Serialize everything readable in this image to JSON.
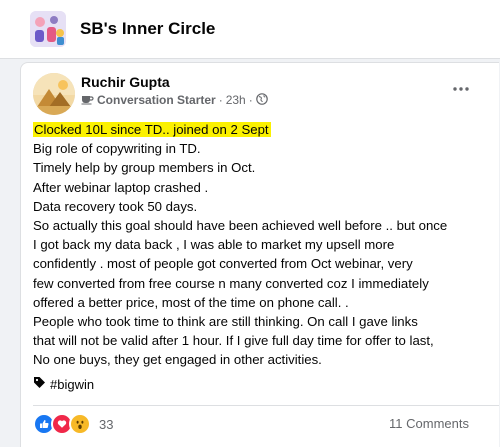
{
  "group": {
    "name": "SB's Inner Circle"
  },
  "post": {
    "author": "Ruchir Gupta",
    "badge_label": "Conversation Starter",
    "time": "23h",
    "lines": {
      "l0": "Clocked 10L since TD.. joined on 2 Sept",
      "l1": "Big role of copywriting in TD.",
      "l2": "Timely help by group members in Oct.",
      "l3": "After webinar laptop crashed .",
      "l4": "Data recovery took 50 days.",
      "l5": "So actually this goal should have been achieved well before .. but once",
      "l6": "I got back my data back , I was able to market my upsell more",
      "l7": "confidently .  most of people got converted from Oct webinar,  very",
      "l8": "few converted from free course n many converted coz I immediately",
      "l9": "offered a better price, most of the time on phone call. .",
      "l10": "People who took time to think are still thinking. On call I gave links",
      "l11": "that will not be valid after 1 hour. If I give full day time for offer to last,",
      "l12": "No one buys, they get engaged in other activities."
    },
    "hashtag": "#bigwin",
    "reaction_count": "33",
    "comments_label": "11 Comments",
    "icons": {
      "badge": "coffee-cup-icon",
      "privacy": "globe-icon",
      "more": "more-horizontal-icon",
      "tag": "tag-icon",
      "reactions": [
        "like-icon",
        "love-icon",
        "wow-icon"
      ]
    }
  },
  "colors": {
    "highlight": "#fbf100",
    "like": "#1877f2",
    "love": "#f02849",
    "wow": "#f7b928",
    "secondary_text": "#65676b"
  }
}
